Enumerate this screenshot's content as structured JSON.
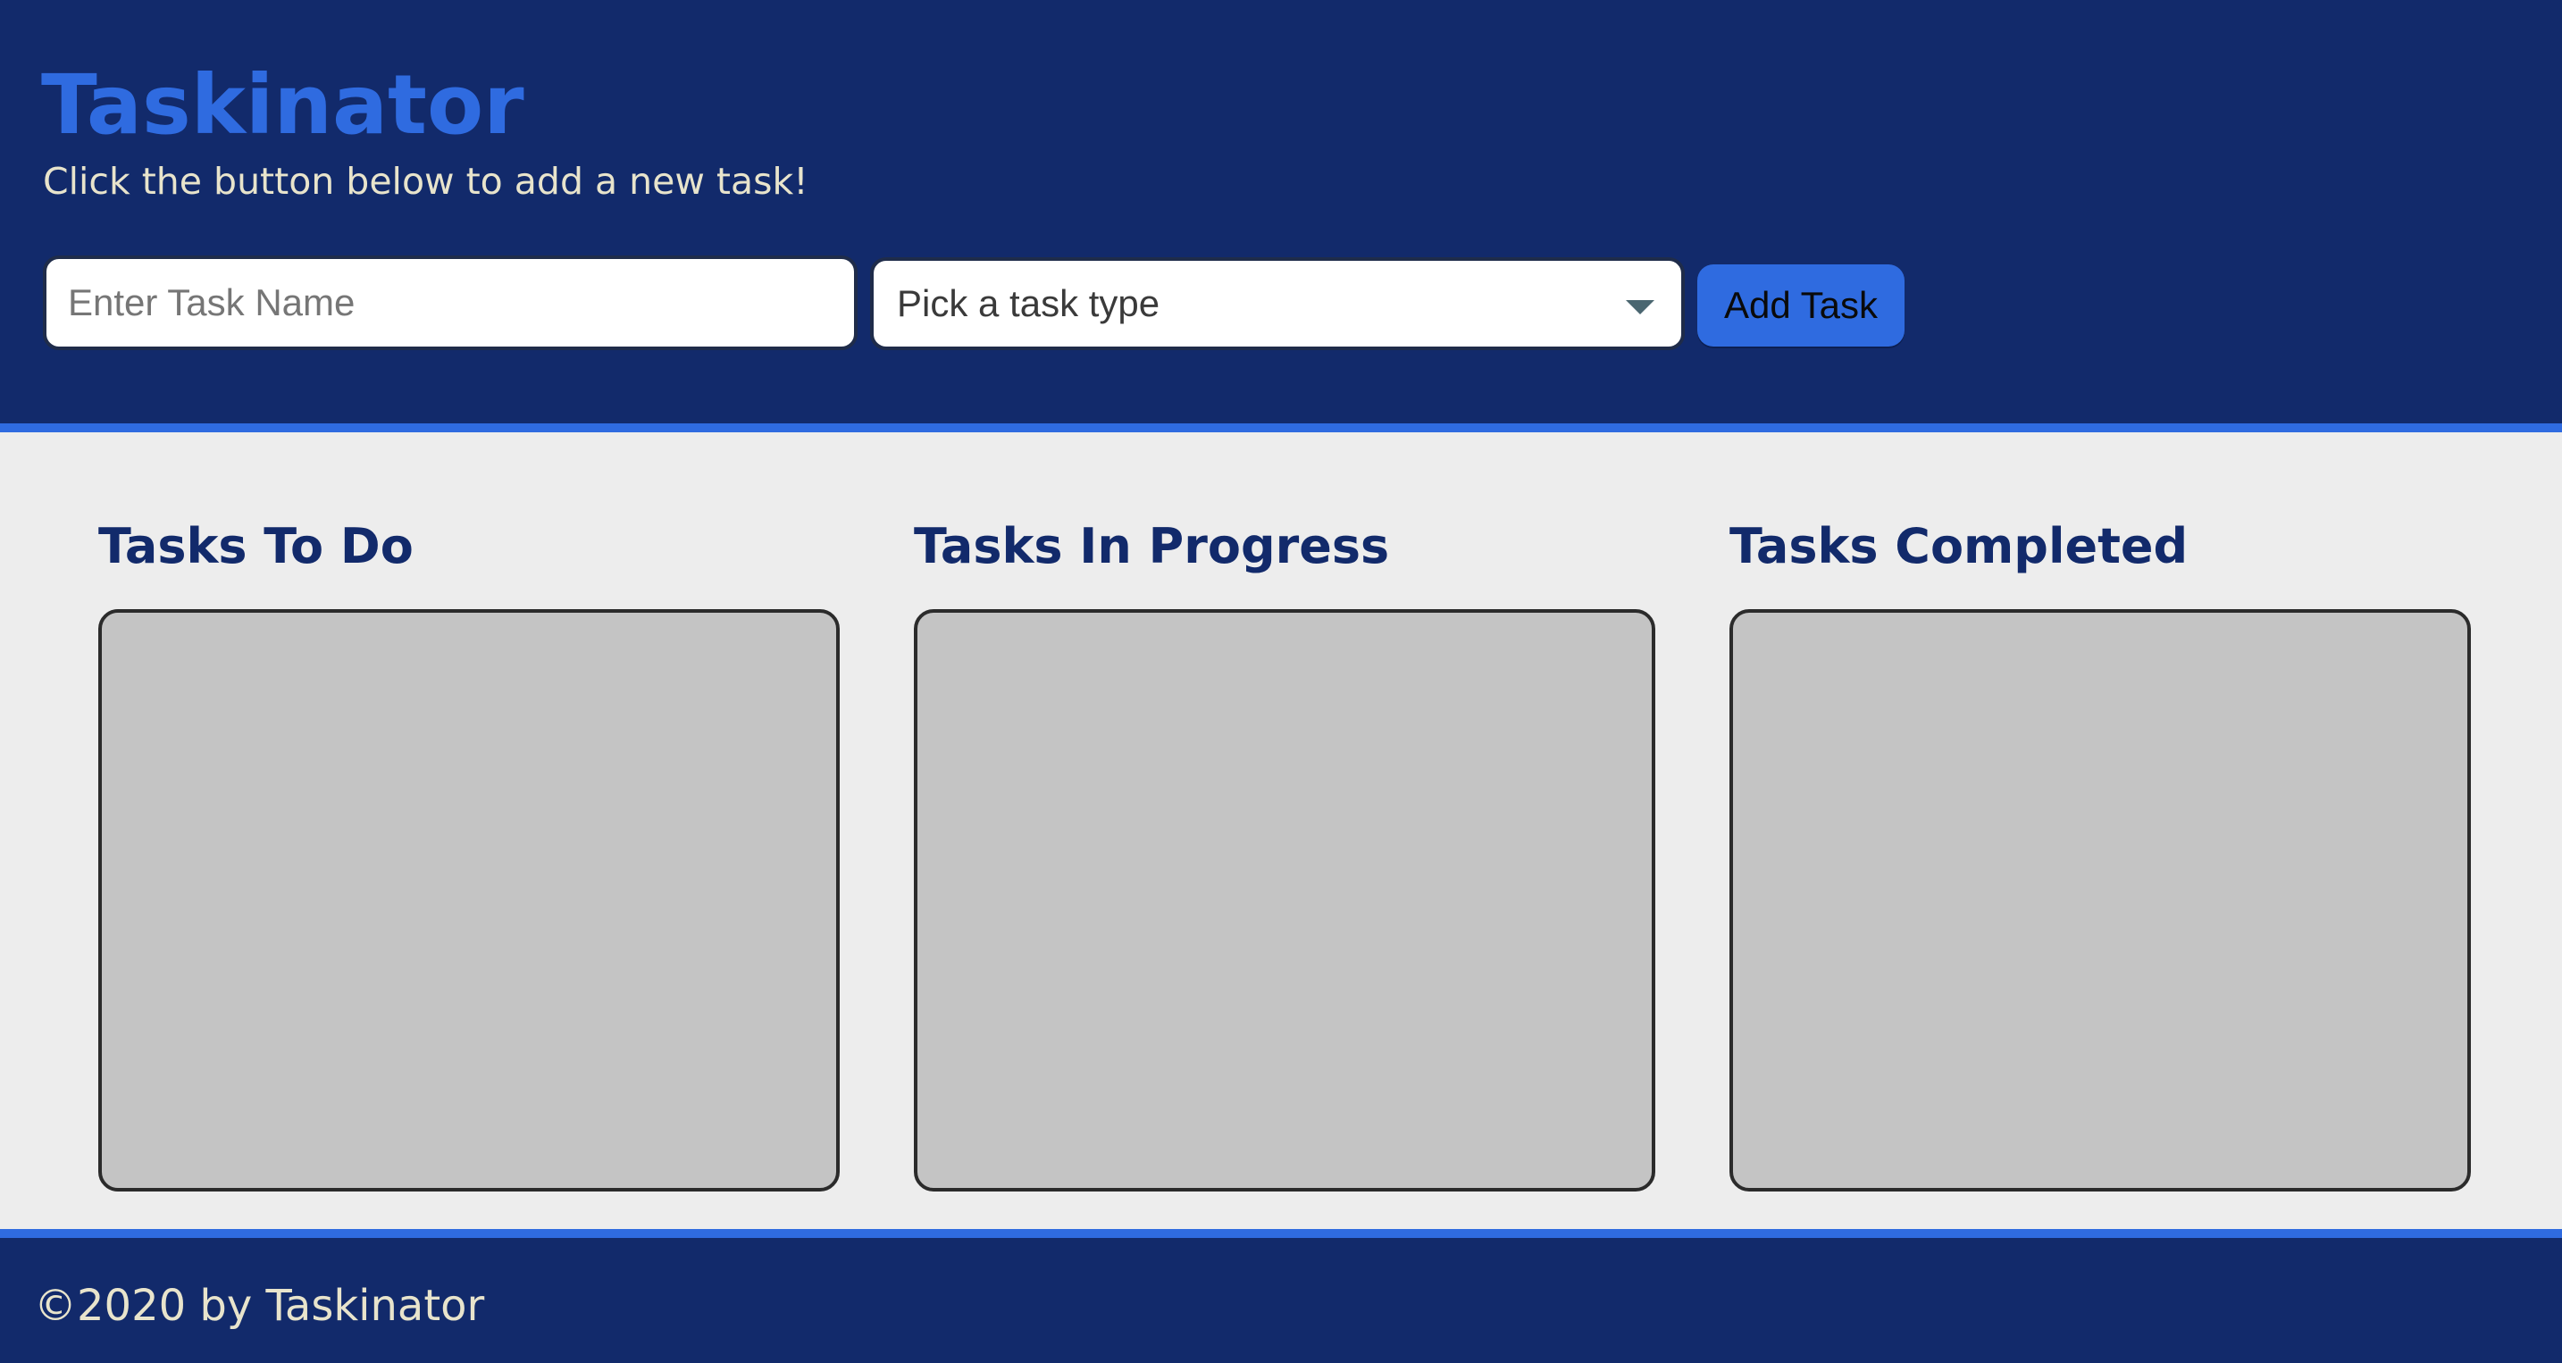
{
  "header": {
    "title": "Taskinator",
    "subtitle": "Click the button below to add a new task!"
  },
  "form": {
    "task_name_placeholder": "Enter Task Name",
    "task_name_value": "",
    "task_type_selected": "Pick a task type",
    "add_task_label": "Add Task"
  },
  "columns": [
    {
      "title": "Tasks To Do",
      "tasks": []
    },
    {
      "title": "Tasks In Progress",
      "tasks": []
    },
    {
      "title": "Tasks Completed",
      "tasks": []
    }
  ],
  "footer": {
    "text": "©2020 by Taskinator"
  },
  "colors": {
    "header_bg": "#122a6b",
    "accent": "#2f6be0",
    "subtitle_text": "#e8e4cc",
    "page_bg": "#ededed",
    "task_list_bg": "#c4c4c4"
  },
  "icons": {
    "select_arrow": "chevron-down-icon"
  }
}
